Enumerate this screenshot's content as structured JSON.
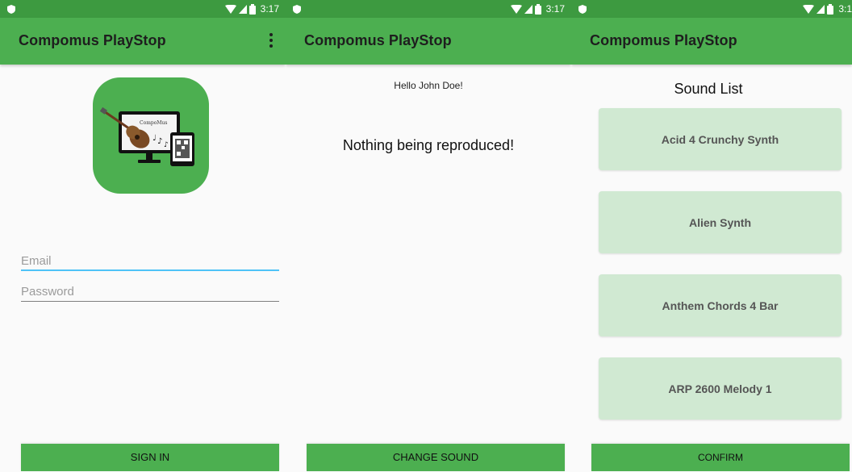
{
  "status_bar": {
    "time": "3:17",
    "time_cut": "3:1"
  },
  "app": {
    "title": "Compomus PlayStop"
  },
  "login": {
    "logo_text": "CompoMus",
    "email_placeholder": "Email",
    "password_placeholder": "Password",
    "sign_in_label": "SIGN IN"
  },
  "player": {
    "greeting": "Hello John Doe!",
    "status": "Nothing being reproduced!",
    "change_sound_label": "CHANGE SOUND"
  },
  "sounds": {
    "title": "Sound List",
    "items": [
      "Acid 4 Crunchy Synth",
      "Alien Synth",
      "Anthem Chords 4 Bar",
      "ARP 2600 Melody 1"
    ],
    "confirm_label": "CONFIRM"
  },
  "colors": {
    "status_bar": "#3d9a40",
    "app_bar": "#4caf50",
    "focused_line": "#4fc3f7",
    "sound_item": "#d0e9d2"
  }
}
